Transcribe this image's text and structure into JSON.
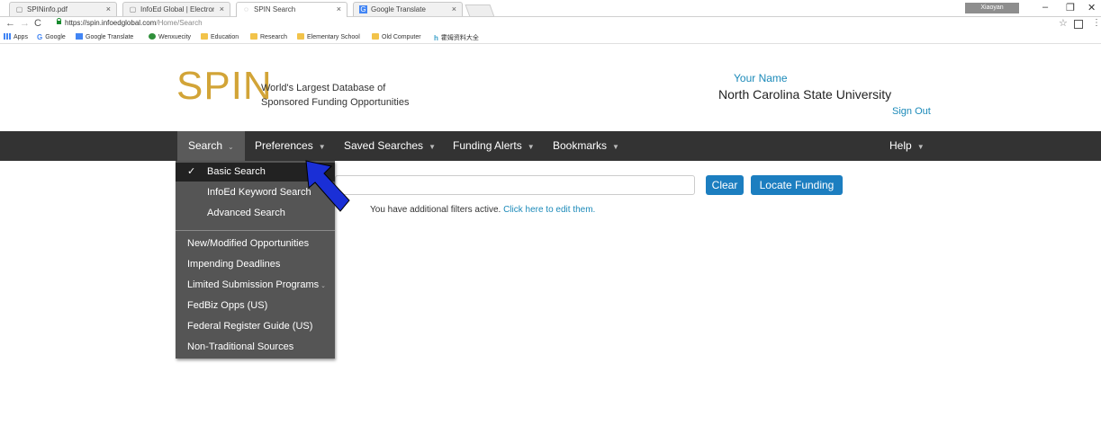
{
  "browser": {
    "tabs": [
      {
        "title": "SPINinfo.pdf",
        "icon": "document-icon",
        "active": false
      },
      {
        "title": "InfoEd Global | Electroni",
        "icon": "document-icon",
        "active": false
      },
      {
        "title": "SPIN Search",
        "icon": "loading-icon",
        "active": true
      },
      {
        "title": "Google Translate",
        "icon": "google-translate-icon",
        "active": false
      }
    ],
    "tab_close": "×",
    "user_badge": "Xiaoyan",
    "window_controls": {
      "minimize": "–",
      "restore": "❐",
      "close": "✕"
    },
    "url_host": "https://spin.infoedglobal.com",
    "url_path": "/Home/Search",
    "bookmarks": [
      {
        "label": "Apps",
        "icon": "apps-icon"
      },
      {
        "label": "Google",
        "icon": "google-icon"
      },
      {
        "label": "Google Translate",
        "icon": "google-translate-icon"
      },
      {
        "label": "Wenxuecity",
        "icon": "wenxuecity-icon"
      },
      {
        "label": "Education",
        "icon": "folder-icon"
      },
      {
        "label": "Research",
        "icon": "folder-icon"
      },
      {
        "label": "Elementary School",
        "icon": "folder-icon"
      },
      {
        "label": "Old Computer",
        "icon": "folder-icon"
      },
      {
        "label": "霍姆资料大全",
        "icon": "h-icon"
      }
    ]
  },
  "header": {
    "logo": "SPIN",
    "tagline_line1": "World's Largest Database of",
    "tagline_line2": "Sponsored Funding Opportunities",
    "user_name": "Your Name",
    "user_org": "North Carolina State University",
    "sign_out": "Sign Out"
  },
  "nav": {
    "items": [
      "Search",
      "Preferences",
      "Saved Searches",
      "Funding Alerts",
      "Bookmarks",
      "Help"
    ],
    "active": "Search"
  },
  "search": {
    "input_value": "",
    "clear_label": "Clear",
    "locate_label": "Locate Funding",
    "filter_note": "You have additional filters active.",
    "filter_link": "Click here to edit them."
  },
  "dropdown": {
    "items": [
      {
        "label": "Basic Search",
        "selected": true,
        "indented": true
      },
      {
        "label": "InfoEd Keyword Search",
        "selected": false,
        "indented": true
      },
      {
        "label": "Advanced Search",
        "selected": false,
        "indented": true
      },
      {
        "label": "New/Modified Opportunities",
        "selected": false,
        "indented": false
      },
      {
        "label": "Impending Deadlines",
        "selected": false,
        "indented": false
      },
      {
        "label": "Limited Submission Programs",
        "selected": false,
        "indented": false
      },
      {
        "label": "FedBiz Opps (US)",
        "selected": false,
        "indented": false
      },
      {
        "label": "Federal Register Guide (US)",
        "selected": false,
        "indented": false
      },
      {
        "label": "Non-Traditional Sources",
        "selected": false,
        "indented": false
      }
    ],
    "check_mark": "✓"
  },
  "colors": {
    "logo": "#d2a437",
    "link": "#1c8ab9",
    "button": "#1c7ec0",
    "navbar": "#333333",
    "dropdown": "#555555",
    "arrow": "#1a2fd6"
  }
}
